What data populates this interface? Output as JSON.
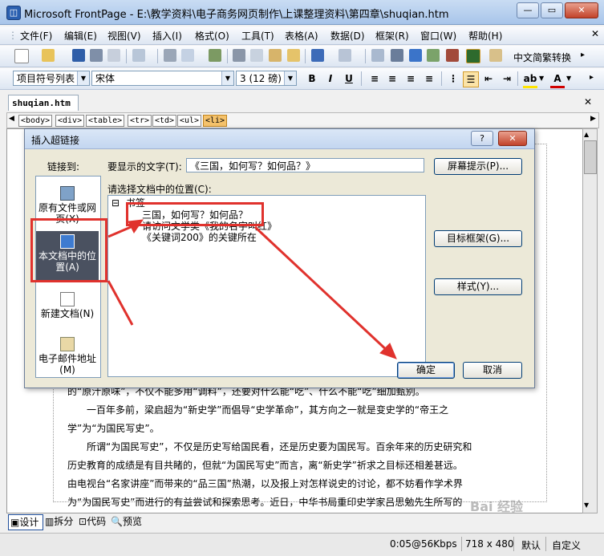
{
  "window": {
    "title": "Microsoft FrontPage - E:\\教学资料\\电子商务网页制作\\上课整理资料\\第四章\\shuqian.htm",
    "minimize": "0",
    "maximize": "1",
    "close": "r"
  },
  "menu": [
    "文件(F)",
    "编辑(E)",
    "视图(V)",
    "插入(I)",
    "格式(O)",
    "工具(T)",
    "表格(A)",
    "数据(D)",
    "框架(R)",
    "窗口(W)",
    "帮助(H)"
  ],
  "toolbar": {
    "lang_convert": "中文简繁转换"
  },
  "format": {
    "style": "项目符号列表",
    "font": "宋体",
    "size": "3 (12 磅)",
    "bold": "B",
    "italic": "I",
    "underline": "U",
    "font_color": "A"
  },
  "document": {
    "tab": "shuqian.htm",
    "tags": [
      "<body>",
      "<div>",
      "<table>",
      "<tr>",
      "<td>",
      "<ul>",
      "<li>"
    ],
    "lines": [
      "的“原汁原味”，不仅不能多用“调料”，还要对什么能“吃”、什么不能“吃”细加甄别。",
      "　　一百年多前，梁启超为“新史学”而倡导“史学革命”，其方向之一就是变史学的“帝王之",
      "学”为“为国民写史”。",
      "　　所谓“为国民写史”，不仅是历史写给国民看，还是历史要为国民写。百余年来的历史研究和",
      "历史教育的成绩是有目共睹的，但就“为国民写史”而言，离“新史学”祈求之目标还相差甚远。",
      "由电视台“名家讲座”而带来的“品三国”热潮，以及报上对怎样说史的讨论，都不妨看作学术界",
      "为“为国民写史”而进行的有益尝试和探索思考。近日，中华书局重印史学家吕思勉先生所写的"
    ]
  },
  "view_tabs": [
    "设计",
    "拆分",
    "代码",
    "预览"
  ],
  "status": {
    "speed": "0:05@56Kbps",
    "size": "718 x 480",
    "mode": "默认",
    "custom": "自定义"
  },
  "watermark": "Bai 经验",
  "dialog": {
    "title": "插入超链接",
    "help": "?",
    "close": "r",
    "link_to": "链接到:",
    "text_label": "要显示的文字(T):",
    "text_value": "《三国，如何写？如何品？》",
    "screen_tip": "屏幕提示(P)...",
    "tree_label": "请选择文档中的位置(C):",
    "tree_root": "书签",
    "tree_items": [
      "三国，如何写？如何品？",
      "请访问文学类《我的名字叫红》",
      "《关键词200》的关键所在"
    ],
    "link_options": [
      {
        "label": "原有文件或网页(X)",
        "icon": "globe-file-icon"
      },
      {
        "label": "本文档中的位置(A)",
        "icon": "document-anchor-icon"
      },
      {
        "label": "新建文档(N)",
        "icon": "new-document-icon"
      },
      {
        "label": "电子邮件地址(M)",
        "icon": "email-icon"
      }
    ],
    "target_frame": "目标框架(G)...",
    "style": "样式(Y)...",
    "ok": "确定",
    "cancel": "取消"
  }
}
